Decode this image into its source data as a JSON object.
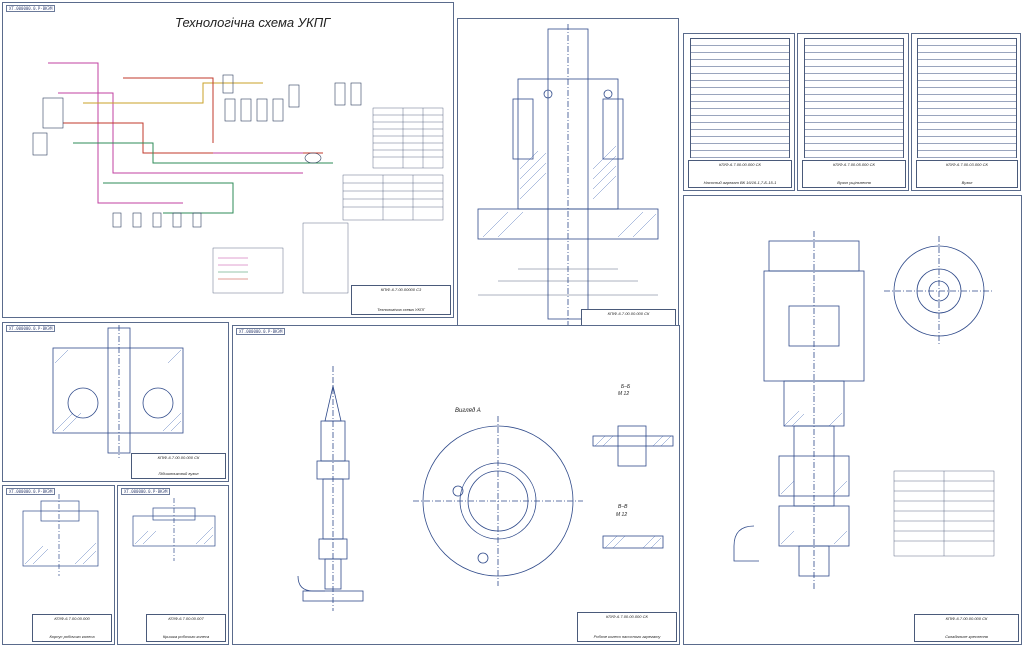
{
  "sheets": {
    "scheme": {
      "tag": "ХТ.000000.0.Р-ВКЭМ",
      "title": "Технологічна схема  УКПГ",
      "stamp_code": "КПІФ-6.7.00.00000 С3",
      "stamp_name": "Технологічна схема УКПГ"
    },
    "section": {
      "tag": "ХТ.000000.0.Р-ВКЭМ",
      "stamp_code": "КПІФ-6.7.00.00.000 СК",
      "stamp_name": "Ущільнення кульового"
    },
    "spec1": {
      "stamp_code": "КПІФ-6.7.00.00.000 СК",
      "stamp_name": "Насосний агрегат ВК 16/16-1,7-Б-15-1"
    },
    "spec2": {
      "stamp_code": "КПІФ-6.7.00.05.000 СК",
      "stamp_name": "Вузол ущільнення"
    },
    "spec3": {
      "stamp_code": "КПІФ-6.7.00.03.000 СК",
      "stamp_name": "Вузол"
    },
    "bearing": {
      "tag": "ХТ.000000.0.Р-ВКЭМ",
      "stamp_code": "КПІФ-6.7.00.00.000 СК",
      "stamp_name": "Підшипниковий вузол"
    },
    "detail1": {
      "tag": "ХТ.000000.0.Р-ВКЭМ",
      "stamp_code": "КПІФ-6.7.00.00.000",
      "stamp_name": "Корпус робочого колеса"
    },
    "detail2": {
      "tag": "ХТ.000000.0.Р-ВКЭМ",
      "stamp_code": "КПІФ-6.7.00.00.007",
      "stamp_name": "Кришка робочого колеса"
    },
    "impeller": {
      "tag": "ХТ.000000.0.Р-ВКЭМ",
      "view_a": "Вигляд А",
      "section_bb": "Б–Б",
      "scale_bb": "М 12",
      "section_vv": "В–В",
      "scale_vv": "М 12",
      "stamp_code": "КПІФ-6.7.00.00.000 СК",
      "stamp_name": "Робоче колесо насосного агрегату"
    },
    "pump": {
      "stamp_code": "КПІФ-6.7.00.00.000 СК",
      "stamp_name": "Складальне креслення"
    }
  },
  "colors": {
    "line": "#2f4a8a",
    "hatch": "#3a5fb0",
    "frame": "#5a6b8c",
    "pipe_red": "#c0392b",
    "pipe_green": "#2e8b57",
    "pipe_magenta": "#c040a0",
    "pipe_yellow": "#c9a227"
  }
}
